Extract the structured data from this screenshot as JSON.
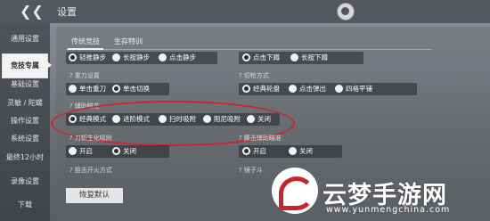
{
  "header": {
    "title": "设置",
    "back_icon": "back-chevron-icon",
    "top_icon": "avatar-badge-icon"
  },
  "sidebar": {
    "items": [
      {
        "label": "通用设置"
      },
      {
        "label": "竞技专属"
      },
      {
        "label": "基础设置"
      },
      {
        "label": "灵敏 / 陀螺"
      },
      {
        "label": "操作设置"
      },
      {
        "label": "系统设置"
      },
      {
        "label": "最终12小时"
      },
      {
        "label": "录像设置"
      },
      {
        "label": "下载"
      }
    ],
    "active_index": 1
  },
  "tabs": [
    {
      "label": "传统竞技"
    },
    {
      "label": "生存特训"
    }
  ],
  "row1": {
    "left": [
      {
        "label": "轻推静步",
        "selected": true
      },
      {
        "label": "长按静步"
      },
      {
        "label": "点击静步"
      }
    ],
    "right": [
      {
        "label": "点击下蹲",
        "selected": true
      },
      {
        "label": "长按下蹲"
      }
    ]
  },
  "row2": {
    "left_title": "重刀设置",
    "left": [
      {
        "label": "单击重刀"
      },
      {
        "label": "单击切换",
        "selected": true
      }
    ],
    "right_title": "切枪方式",
    "right": [
      {
        "label": "经典轮盘",
        "selected": true
      },
      {
        "label": "点击弹出"
      },
      {
        "label": "四格平铺"
      }
    ]
  },
  "row3": {
    "title": "辅助瞄准",
    "options": [
      {
        "label": "经典模式",
        "selected": true
      },
      {
        "label": "进阶模式"
      },
      {
        "label": "扫时吸附"
      },
      {
        "label": "阻尼吸附"
      },
      {
        "label": "关闭"
      }
    ]
  },
  "row4": {
    "left_title": "刀斩生化吸附",
    "left": [
      {
        "label": "开启"
      },
      {
        "label": "关闭",
        "selected": true
      }
    ],
    "right_title": "腰击辅助瞄准",
    "right": [
      {
        "label": "开启",
        "selected": true
      },
      {
        "label": "关闭"
      }
    ]
  },
  "row5": {
    "left_title": "狙击开火方式",
    "right_title": "镜子斗"
  },
  "reset_button": "恢复默认",
  "watermark": {
    "title": "云梦手游网",
    "url": "www.yunmengchina.com"
  },
  "colors": {
    "highlight": "#c8282e",
    "accent": "#ffffff"
  }
}
